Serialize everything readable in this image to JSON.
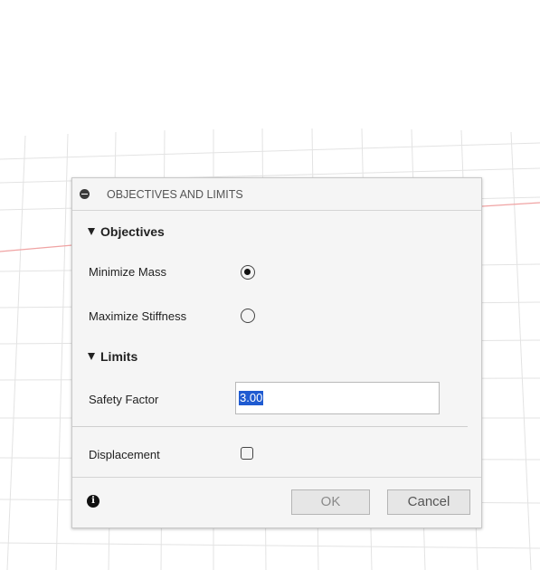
{
  "dialog": {
    "title": "OBJECTIVES AND LIMITS",
    "objectives": {
      "title": "Objectives",
      "options": [
        {
          "label": "Minimize Mass",
          "selected": true
        },
        {
          "label": "Maximize Stiffness",
          "selected": false
        }
      ]
    },
    "limits": {
      "title": "Limits",
      "safety_factor_label": "Safety Factor",
      "safety_factor_value": "3.00",
      "displacement_label": "Displacement",
      "displacement_checked": false
    },
    "footer": {
      "ok_label": "OK",
      "cancel_label": "Cancel"
    }
  },
  "colors": {
    "grid": "#e3e3e3",
    "axis_red": "#f0a3a3",
    "selection": "#1f5bd1"
  },
  "icons": {
    "collapse": "minus-circle-icon",
    "section": "triangle-down-icon",
    "info": "info-icon"
  }
}
